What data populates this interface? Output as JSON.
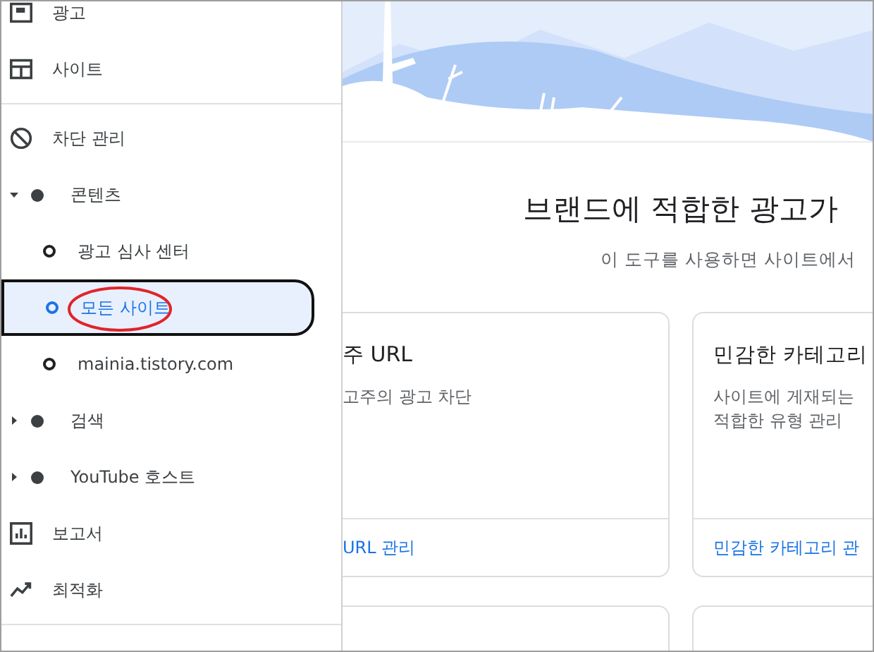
{
  "sidebar": {
    "sections": [
      {
        "items": [
          {
            "label": "광고",
            "selected": false
          },
          {
            "label": "사이트",
            "selected": false
          }
        ]
      },
      {
        "items": [
          {
            "label": "차단 관리",
            "selected": false
          },
          {
            "label": "콘텐츠",
            "kind": "tree",
            "expanded": true,
            "selected": false,
            "children": [
              {
                "label": "광고 심사 센터",
                "selected": false
              },
              {
                "label": "모든 사이트",
                "selected": true
              },
              {
                "label": "mainia.tistory.com",
                "selected": false
              }
            ]
          },
          {
            "label": "검색",
            "kind": "tree",
            "expanded": false,
            "selected": false
          },
          {
            "label": "YouTube 호스트",
            "kind": "tree",
            "expanded": false,
            "selected": false
          },
          {
            "label": "보고서",
            "selected": false
          },
          {
            "label": "최적화",
            "selected": false
          }
        ]
      }
    ]
  },
  "main": {
    "title": "브랜드에 적합한 광고가",
    "subtitle": "이 도구를 사용하면 사이트에서",
    "cards": [
      {
        "title": "주 URL",
        "description": "고주의 광고 차단",
        "link": "URL 관리"
      },
      {
        "title": "민감한 카테고리",
        "description": "사이트에 게재되는\n적합한 유형 관리",
        "link": "민감한 카테고리 관"
      }
    ]
  }
}
